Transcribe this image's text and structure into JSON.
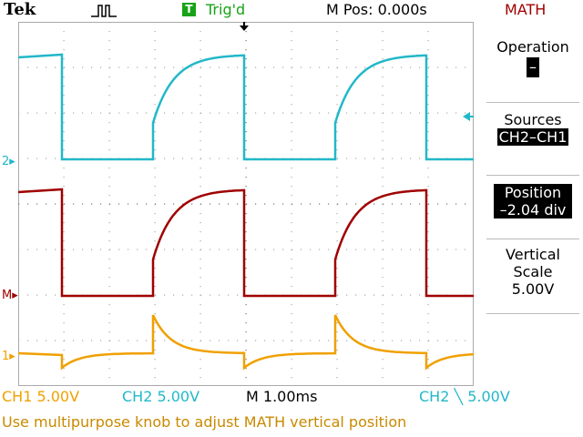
{
  "topbar": {
    "brand": "Tek",
    "trigger_badge": "T",
    "trigger_status": "Trig'd",
    "m_pos": "M Pos: 0.000s",
    "menu_title": "MATH"
  },
  "side_menu": {
    "operation_label": "Operation",
    "operation_value": "–",
    "sources_label": "Sources",
    "sources_value": "CH2–CH1",
    "position_label": "Position",
    "position_value": "–2.04 div",
    "vscale_label1": "Vertical",
    "vscale_label2": "Scale",
    "vscale_value": "5.00V"
  },
  "channel_markers": {
    "ch2": "2",
    "math": "M",
    "ch1": "1"
  },
  "bottom": {
    "ch1": "CH1  5.00V",
    "ch2": "CH2  5.00V",
    "timebase": "M 1.00ms",
    "trigger": "CH2 ╲ 5.00V",
    "status_message": "Use multipurpose knob to adjust MATH vertical position"
  },
  "colors": {
    "ch1": "#f0a000",
    "ch2": "#22b8c8",
    "math": "#a00000",
    "grid": "#999999",
    "trigger": "#17a317"
  }
}
